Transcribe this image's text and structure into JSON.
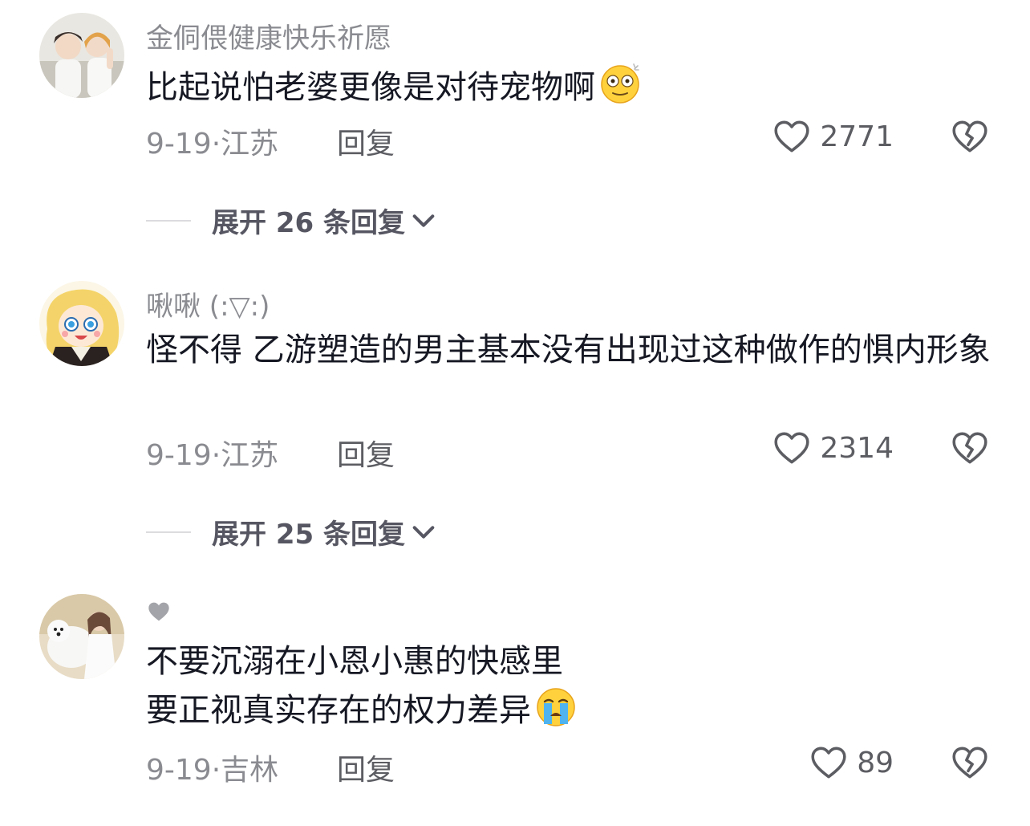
{
  "comments": [
    {
      "username": "金侗偎健康快乐祈愿",
      "text": "比起说怕老婆更像是对待宠物啊",
      "emoji": "dazed-face-emoji",
      "date": "9-19",
      "location": "江苏",
      "reply_label": "回复",
      "likes": "2771",
      "expand_label": "展开 26 条回复"
    },
    {
      "username": "啾啾 (:▽:)",
      "text": "怪不得 乙游塑造的男主基本没有出现过这种做作的惧内形象",
      "date": "9-19",
      "location": "江苏",
      "reply_label": "回复",
      "likes": "2314",
      "expand_label": "展开 25 条回复"
    },
    {
      "username": "",
      "username_icon": "heart-icon",
      "text_line1": "不要沉溺在小恩小惠的快感里",
      "text_line2": "要正视真实存在的权力差异",
      "emoji": "crying-face-emoji",
      "date": "9-19",
      "location": "吉林",
      "reply_label": "回复",
      "likes": "89"
    }
  ]
}
